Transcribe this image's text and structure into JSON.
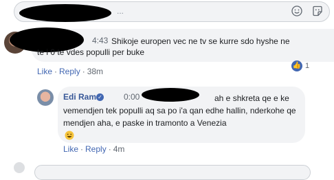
{
  "reply_input": {
    "placeholder_tail": "..."
  },
  "comment1": {
    "time_label": "4:43",
    "text": "Shikoje europen vec ne tv se kurre sdo hyshe ne te i 0 te vdes populli per buke",
    "actions": {
      "like": "Like",
      "reply": "Reply",
      "age": "38m"
    },
    "reaction_count": "1"
  },
  "comment2": {
    "author": "Edi Rama",
    "time_label": "0:00",
    "text": "ah e shkreta qe e ke vemendjen tek populli aq sa po i'a qan edhe hallin, nderkohe qe mendjen aha, e paske in tramonto a Venezia",
    "actions": {
      "like": "Like",
      "reply": "Reply",
      "age": "4m"
    }
  },
  "icons": {
    "emoji": "smiley-icon",
    "sticker": "sticker-icon",
    "like": "thumbs-up-icon",
    "verified": "verified-check-icon"
  },
  "colors": {
    "link": "#4267b2",
    "bubble": "#f2f3f5",
    "muted": "#606770"
  }
}
